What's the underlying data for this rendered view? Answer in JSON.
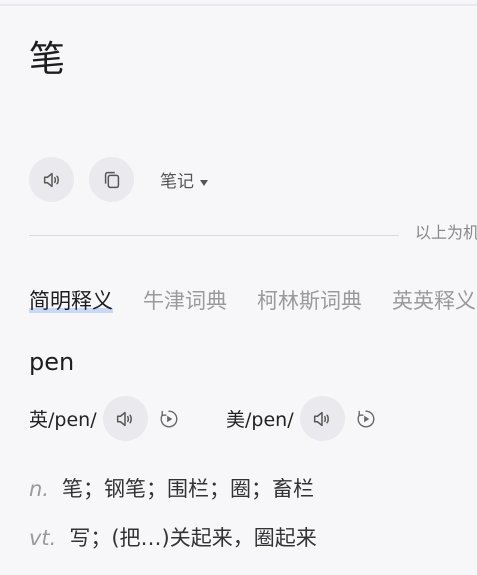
{
  "word": "笔",
  "actions": {
    "speak_icon": "speaker-icon",
    "copy_icon": "copy-icon",
    "notes_label": "笔记"
  },
  "divider_text": "以上为机",
  "tabs": [
    {
      "label": "简明释义",
      "active": true
    },
    {
      "label": "牛津词典",
      "active": false
    },
    {
      "label": "柯林斯词典",
      "active": false
    },
    {
      "label": "英英释义",
      "active": false
    }
  ],
  "entry": {
    "headword": "pen",
    "uk": {
      "label": "英",
      "phonetic": "/pen/"
    },
    "us": {
      "label": "美",
      "phonetic": "/pen/"
    },
    "definitions": [
      {
        "pos": "n.",
        "meaning": "笔；钢笔；围栏；圈；畜栏"
      },
      {
        "pos": "vt.",
        "meaning": "写；(把…)关起来，圈起来"
      }
    ]
  },
  "colors": {
    "background": "#f7f7f9",
    "button_bg": "#e9e9ee",
    "active_tab_highlight": "#c9d8f9",
    "inactive_text": "#9a9a9a"
  }
}
